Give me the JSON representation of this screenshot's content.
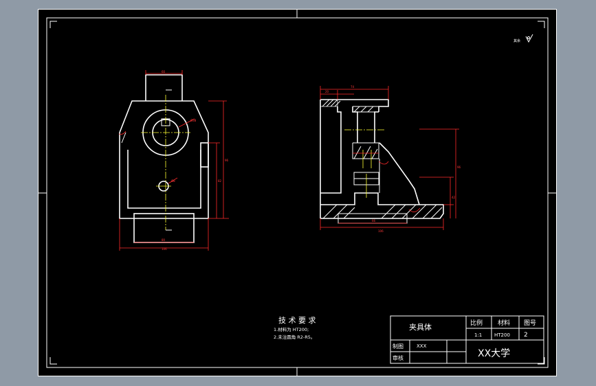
{
  "tech_requirements": {
    "title": "技 术 要 求",
    "line1": "1.材料为 HT200;",
    "line2": "2.未注圆角 R2-R5。"
  },
  "roughness_note": "其余",
  "title_block": {
    "part_name": "夹具体",
    "scale_label": "比例",
    "material_label": "材料",
    "drawing_no_label": "图号",
    "scale_value": "1:1",
    "material_value": "HT200",
    "drawing_no_value": "2",
    "drafter_label": "制图",
    "drafter_name": "XXX",
    "reviewer_label": "审核",
    "school": "XX大学"
  },
  "colors": {
    "page_background": "#8f9aa6",
    "sheet": "#000000",
    "outline": "#ffffff",
    "dimension": "#ff2a2a",
    "centerline": "#ffff33"
  }
}
